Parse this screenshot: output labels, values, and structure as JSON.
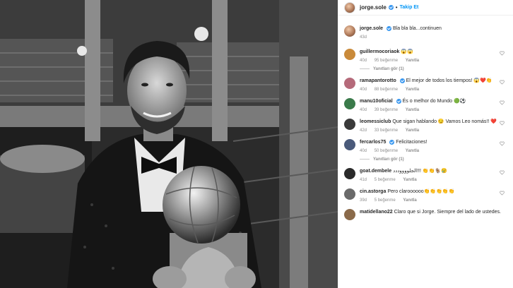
{
  "post": {
    "username": "jorge.sole",
    "follow_label": "Takip Et",
    "separator": "•"
  },
  "caption": {
    "username": "jorge.sole",
    "text": "Bla bla bla...continuen",
    "time": "43d"
  },
  "comments": [
    {
      "username": "guillermocoriaok",
      "text": "😱😱",
      "time": "40d",
      "likes": "95 beğenme",
      "reply": "Yanıtla"
    },
    {
      "username": "ramapantorotto",
      "text": "El mejor de todos los tiempos! 😱❤️👏",
      "time": "40d",
      "likes": "88 beğenme",
      "reply": "Yanıtla"
    },
    {
      "username": "manu10oficial",
      "text": "És o melhor do Mundo 🟢⚽",
      "time": "40d",
      "likes": "39 beğenme",
      "reply": "Yanıtla"
    },
    {
      "username": "leomessiclub",
      "text": "Que sigan hablando 😏 Vamos Leo nomás!! ❤️",
      "time": "42d",
      "likes": "33 beğenme",
      "reply": "Yanıtla"
    },
    {
      "username": "fercarlos75",
      "text": "Felicitaciones!",
      "time": "40d",
      "likes": "50 beğenme",
      "reply": "Yanıtla"
    },
    {
      "username": "goat.dembele",
      "text": "الجلووووددد!!! 👏👏🐐😢",
      "time": "41d",
      "likes": "5 beğenme",
      "reply": "Yanıtla"
    },
    {
      "username": "cin.astorga",
      "text": "Pero claroooooo👏👏👏👏👏",
      "time": "39d",
      "likes": "5 beğenme",
      "reply": "Yanıtla"
    },
    {
      "username": "matidellano22",
      "text": "Claro que si Jorge. Siempre del lado de ustedes.",
      "time": "",
      "likes": "",
      "reply": ""
    }
  ],
  "view_replies": {
    "first": "Yanıtları gör (1)",
    "second": "Yanıtları gör (1)"
  },
  "colors": {
    "link_blue": "#0095f6",
    "verified_blue": "#3897f0",
    "meta_gray": "#8e8e8e"
  },
  "icons": [
    "verified-icon",
    "heart-icon",
    "avatar"
  ]
}
